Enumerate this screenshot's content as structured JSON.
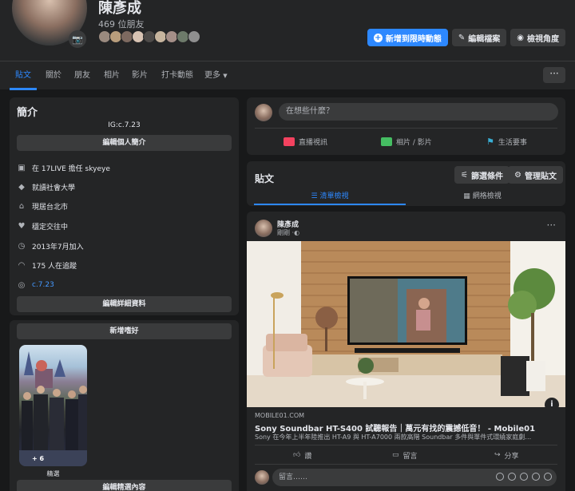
{
  "profile": {
    "name": "陳彥成",
    "friends_count": "469 位朋友"
  },
  "header_buttons": {
    "add_story": "新增到限時動態",
    "edit_profile": "編輯檔案",
    "view_as": "檢視角度"
  },
  "tabs": [
    "貼文",
    "關於",
    "朋友",
    "相片",
    "影片",
    "打卡動態",
    "更多"
  ],
  "tabs_more_button": "···",
  "intro": {
    "title": "簡介",
    "bio": "IG:c.7.23",
    "edit_bio_button": "編輯個人簡介",
    "items": [
      {
        "icon": "briefcase-icon",
        "text": "在 17LIVE 擔任 skyeye"
      },
      {
        "icon": "graduation-cap-icon",
        "text": "就讀社會大學"
      },
      {
        "icon": "home-icon",
        "text": "現居台北市"
      },
      {
        "icon": "heart-icon",
        "text": "穩定交往中"
      },
      {
        "icon": "clock-icon",
        "text": "2013年7月加入"
      },
      {
        "icon": "rss-icon",
        "text": "175 人在追蹤"
      },
      {
        "icon": "instagram-icon",
        "text": "c.7.23"
      }
    ],
    "edit_details_button": "編輯詳細資料",
    "add_hobbies_button": "新增嗜好",
    "featured": {
      "count_label": "+ 6",
      "caption": "精選"
    },
    "edit_featured_button": "編輯精選內容"
  },
  "composer": {
    "placeholder": "在想些什麼？",
    "actions": [
      "直播視訊",
      "相片 / 影片",
      "生活要事"
    ]
  },
  "posts_header": {
    "title": "貼文",
    "filter_button": "篩選條件",
    "manage_button": "管理貼文",
    "view_tabs": [
      "清單檢視",
      "網格檢視"
    ]
  },
  "post": {
    "author": "陳彥成",
    "time": "剛剛",
    "link_domain": "MOBILE01.COM",
    "link_title": "Sony Soundbar HT-S400 試聽報告｜萬元有找的震撼低音！ - Mobile01",
    "link_desc": "Sony 在今年上半年陸推出 HT-A9 與 HT-A7000 兩款高階 Soundbar 多件與單件式環繞家庭劇…",
    "actions": [
      "讚",
      "留言",
      "分享"
    ],
    "comment_placeholder": "留言……"
  },
  "colors": {
    "background": "#18191a",
    "card": "#242526",
    "button": "#3a3b3c",
    "accent": "#2d88ff",
    "text": "#e4e6eb",
    "muted": "#b0b3b8"
  }
}
